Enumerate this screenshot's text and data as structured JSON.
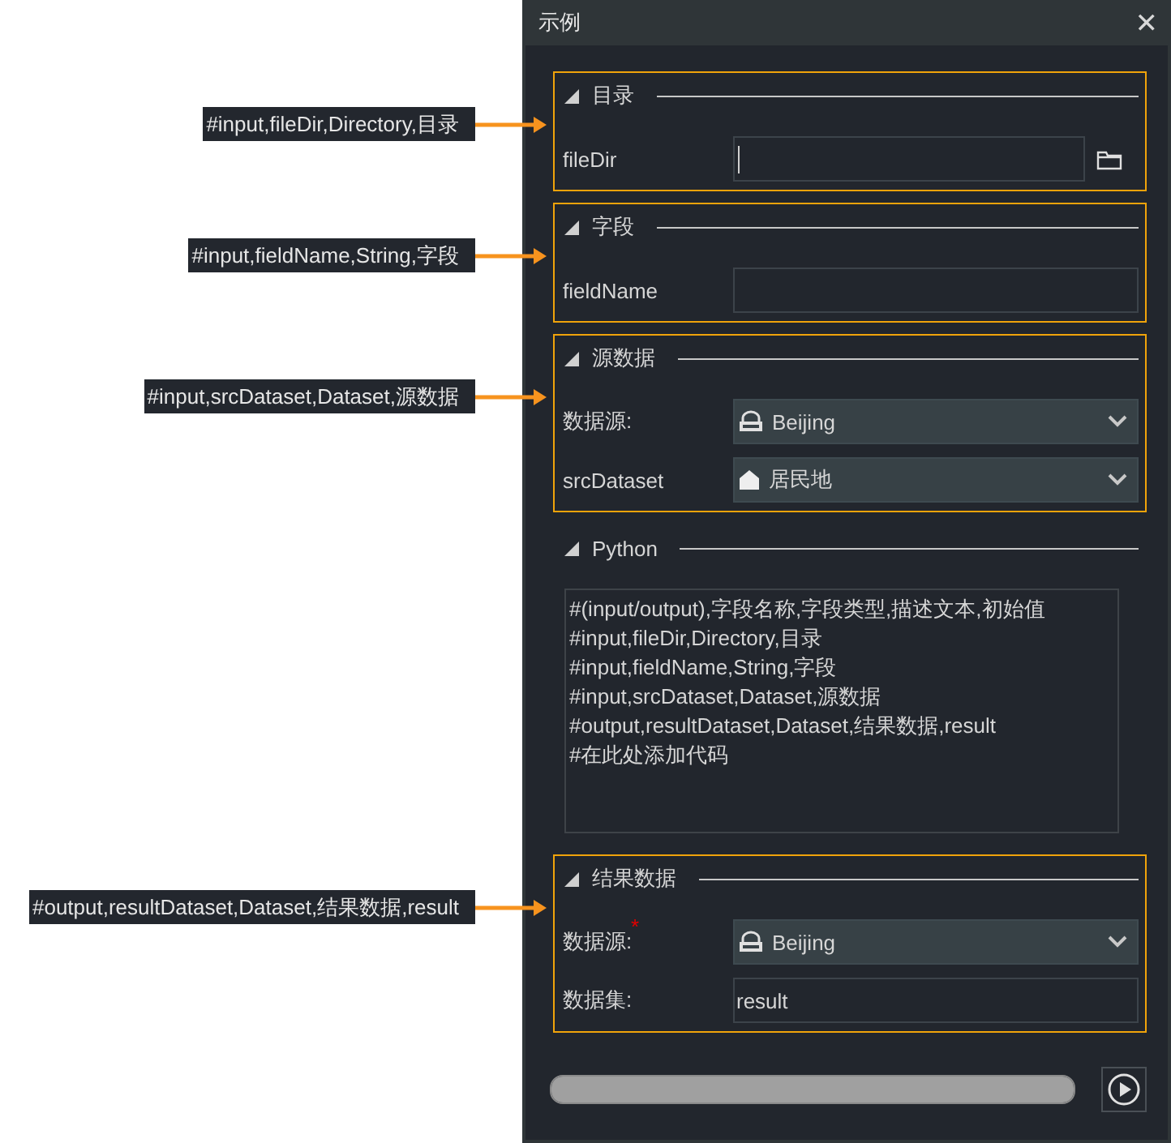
{
  "callouts": [
    {
      "text": "#input,fileDir,Directory,目录"
    },
    {
      "text": "#input,fieldName,String,字段"
    },
    {
      "text": "#input,srcDataset,Dataset,源数据"
    },
    {
      "text": "#output,resultDataset,Dataset,结果数据,result"
    }
  ],
  "window": {
    "title": "示例",
    "close": "✕"
  },
  "sections": [
    {
      "title": "目录",
      "expanded": true,
      "highlighted": true,
      "rows": [
        {
          "kind": "path",
          "label": "fileDir",
          "focused": true
        }
      ]
    },
    {
      "title": "字段",
      "expanded": true,
      "highlighted": true,
      "rows": [
        {
          "kind": "text",
          "label": "fieldName"
        }
      ]
    },
    {
      "title": "源数据",
      "expanded": true,
      "highlighted": true,
      "rows": [
        {
          "kind": "datasource",
          "label": "数据源:",
          "value": "Beijing"
        },
        {
          "kind": "dataset",
          "label": "srcDataset",
          "value": "居民地"
        }
      ]
    },
    {
      "title": "Python",
      "expanded": true,
      "highlighted": false,
      "code": [
        "#(input/output),字段名称,字段类型,描述文本,初始值",
        "#input,fileDir,Directory,目录",
        "#input,fieldName,String,字段",
        "#input,srcDataset,Dataset,源数据",
        "#output,resultDataset,Dataset,结果数据,result",
        "#在此处添加代码"
      ]
    },
    {
      "title": "结果数据",
      "expanded": true,
      "highlighted": true,
      "rows": [
        {
          "kind": "datasource",
          "label": "数据源:",
          "value": "Beijing",
          "required_mark": "*"
        },
        {
          "kind": "text",
          "label": "数据集:",
          "value": "result"
        }
      ]
    }
  ],
  "progress": {
    "level": 1
  }
}
